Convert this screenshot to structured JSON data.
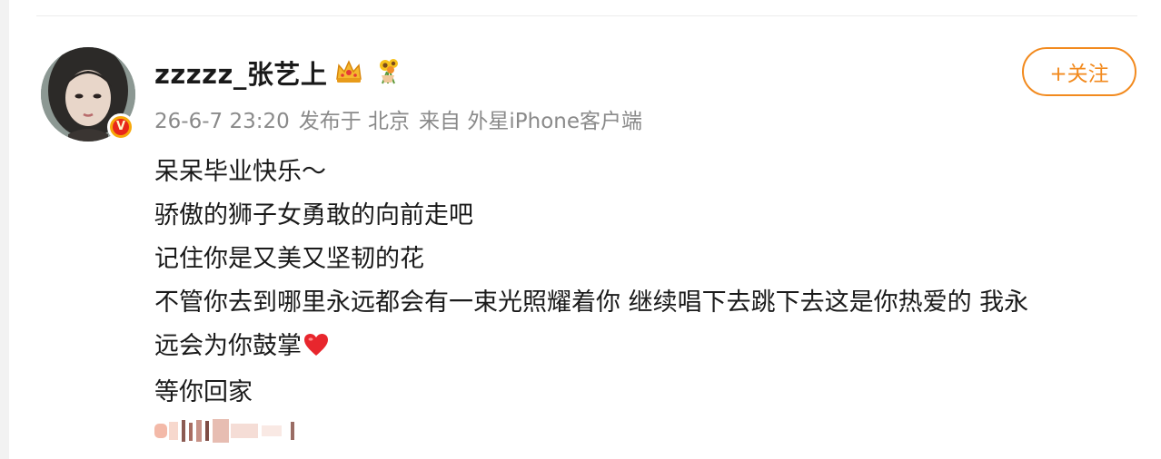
{
  "post": {
    "author": {
      "name": "zzzzz_张艺上",
      "badges": [
        "crown-icon",
        "sunflower-bouquet-icon"
      ],
      "verified_badge_icon": "vip-v-badge-icon"
    },
    "meta": {
      "time": "26-6-7 23:20",
      "location": "发布于 北京",
      "source": "来自 外星iPhone客户端"
    },
    "follow_button_label": "+关注",
    "content_lines": [
      "呆呆毕业快乐～",
      "骄傲的狮子女勇敢的向前走吧",
      "记住你是又美又坚韧的花",
      "不管你去到哪里永远都会有一束光照耀着你 继续唱下去跳下去这是你热爱的 我永",
      "远会为你鼓掌",
      "等你回家"
    ],
    "emoji": "red-heart-icon"
  },
  "colors": {
    "accent": "#f28a1e",
    "text": "#1a1a1a",
    "meta_text": "#8a8a8a",
    "vip_badge": "#f7a80a"
  }
}
